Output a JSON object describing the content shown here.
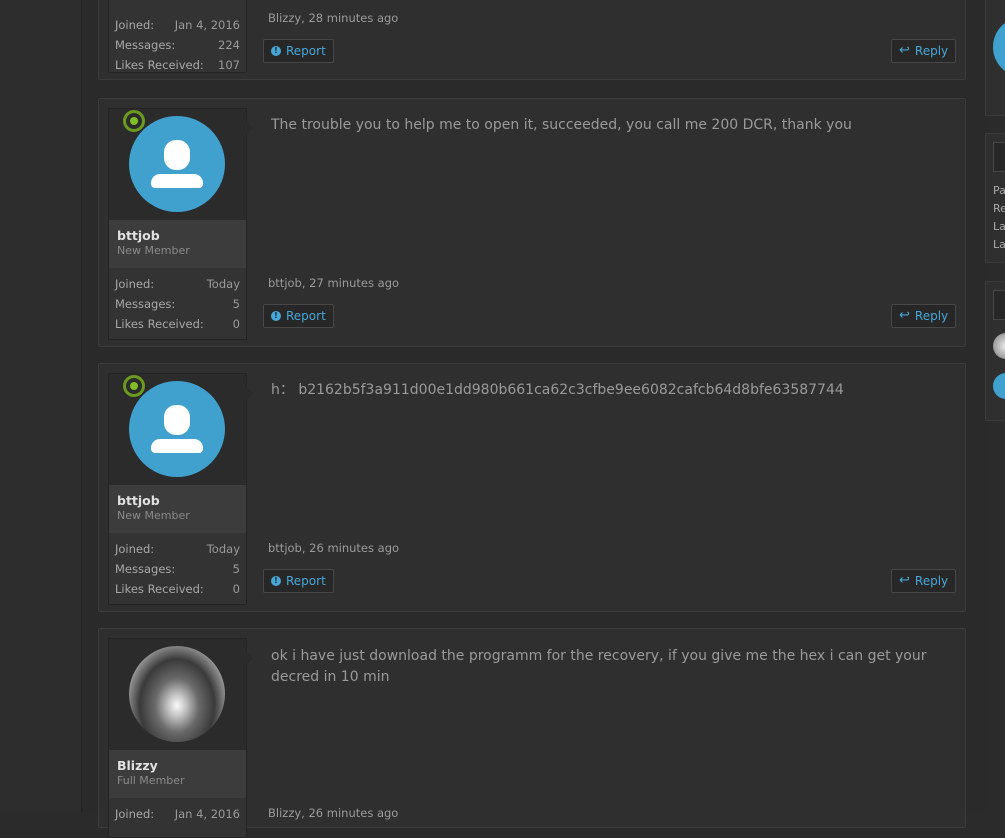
{
  "posts": [
    {
      "message": "",
      "meta": "Blizzy, 28 minutes ago",
      "user": {
        "name": "",
        "role": ""
      },
      "stats": [
        {
          "label": "Joined:",
          "value": "Jan 4, 2016"
        },
        {
          "label": "Messages:",
          "value": "224"
        },
        {
          "label": "Likes Received:",
          "value": "107"
        }
      ],
      "report_label": "Report",
      "reply_label": "Reply"
    },
    {
      "message": "The trouble you to help me to open it, succeeded, you call me 200 DCR, thank you",
      "meta": "bttjob, 27 minutes ago",
      "user": {
        "name": "bttjob",
        "role": "New Member"
      },
      "stats": [
        {
          "label": "Joined:",
          "value": "Today"
        },
        {
          "label": "Messages:",
          "value": "5"
        },
        {
          "label": "Likes Received:",
          "value": "0"
        }
      ],
      "report_label": "Report",
      "reply_label": "Reply"
    },
    {
      "message": "h： b2162b5f3a911d00e1dd980b661ca62c3cfbe9ee6082cafcb64d8bfe63587744",
      "meta": "bttjob, 26 minutes ago",
      "user": {
        "name": "bttjob",
        "role": "New Member"
      },
      "stats": [
        {
          "label": "Joined:",
          "value": "Today"
        },
        {
          "label": "Messages:",
          "value": "5"
        },
        {
          "label": "Likes Received:",
          "value": "0"
        }
      ],
      "report_label": "Report",
      "reply_label": "Reply"
    },
    {
      "message": "ok i have just download the programm for the recovery, if you give me the hex i can get your decred in 10 min",
      "meta": "Blizzy, 26 minutes ago",
      "user": {
        "name": "Blizzy",
        "role": "Full Member"
      },
      "stats": [
        {
          "label": "Joined:",
          "value": "Jan 4, 2016"
        }
      ]
    }
  ],
  "sidebar": {
    "labels": [
      "Pa",
      "Re",
      "La",
      "La"
    ]
  },
  "colors": {
    "accent": "#47a7d8",
    "avatar_bg": "#40a1cf",
    "online": "#7fbf25"
  }
}
